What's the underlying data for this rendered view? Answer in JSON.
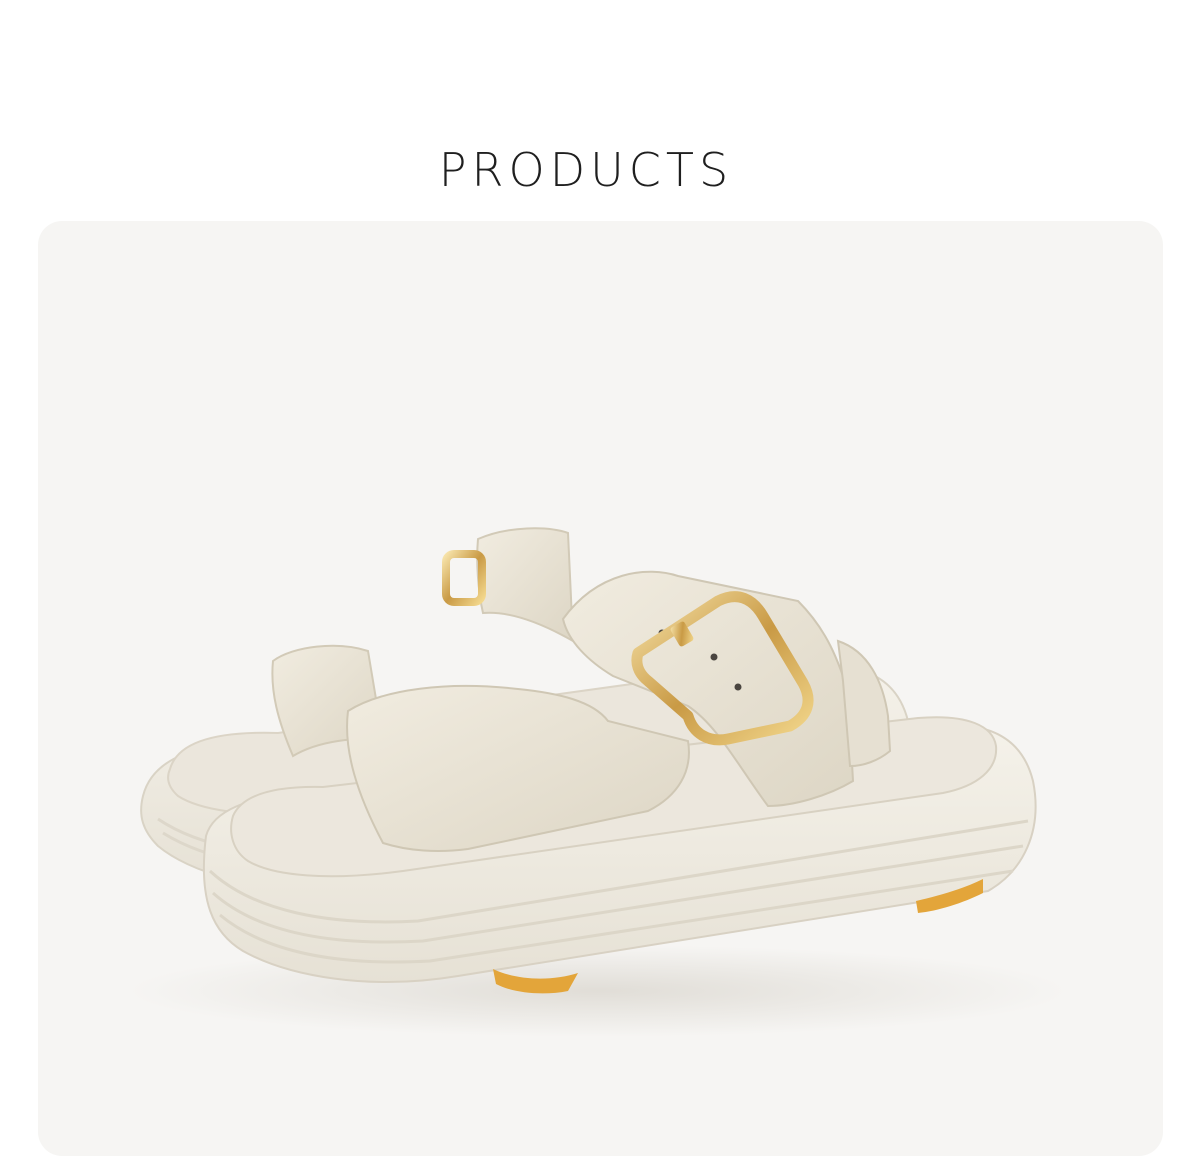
{
  "section": {
    "title": "PRODUCTS"
  },
  "product_image": {
    "subject": "cream-slide-sandal-pair",
    "colors": {
      "background": "#f6f5f3",
      "leather": "#ece6d6",
      "sole": "#f2eee4",
      "buckle": "#d8b56a",
      "outsole_accent": "#e3a53a"
    }
  }
}
